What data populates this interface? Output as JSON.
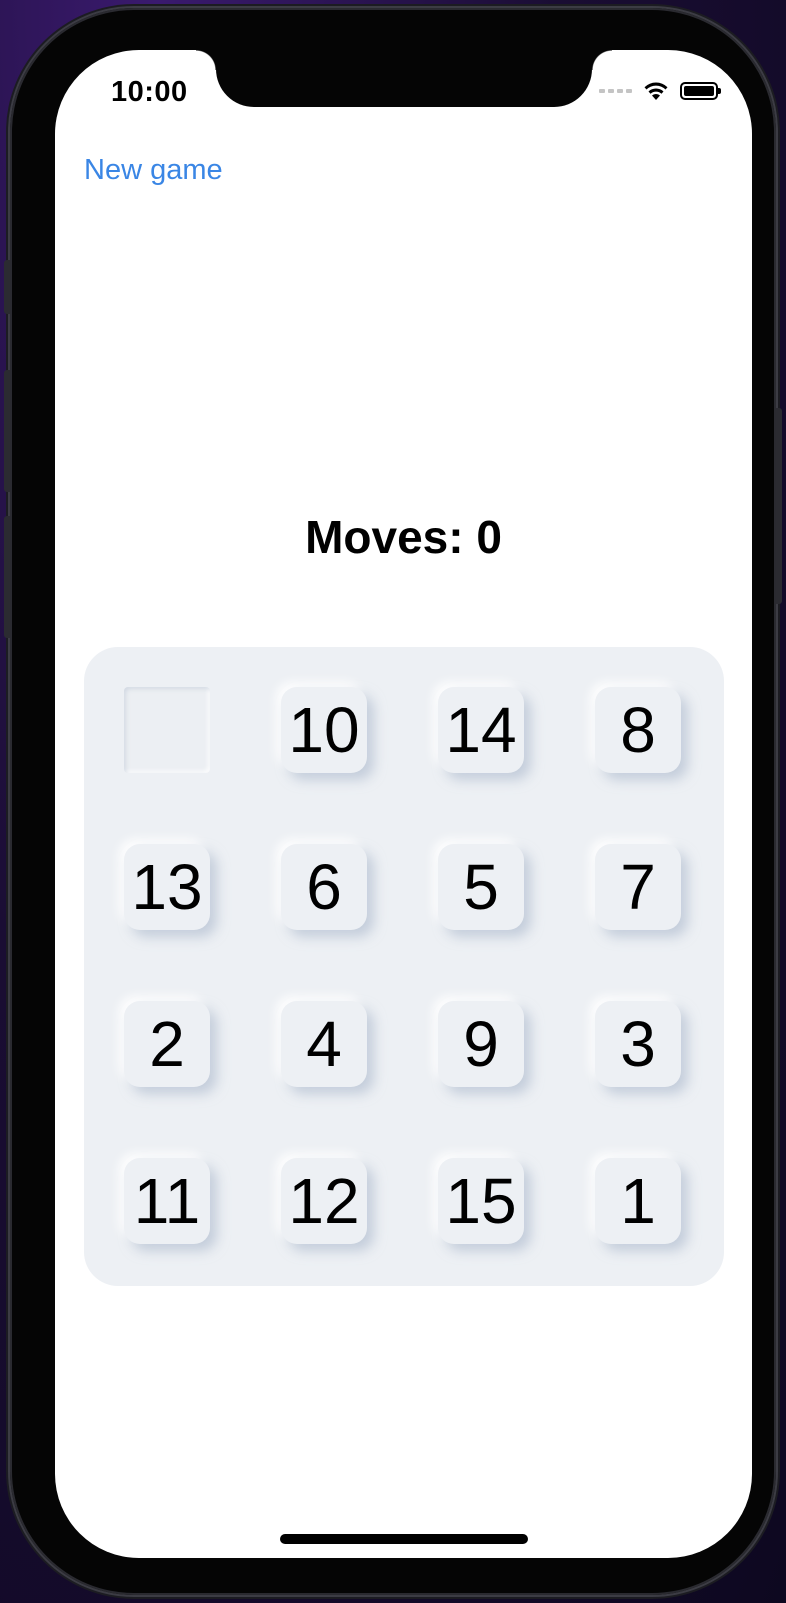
{
  "status_bar": {
    "time": "10:00",
    "icons": [
      "cellular-signal-icon",
      "wifi-icon",
      "battery-icon"
    ]
  },
  "nav": {
    "new_game_label": "New game"
  },
  "game": {
    "moves_text": "Moves: 0",
    "tiles": [
      "",
      "10",
      "14",
      "8",
      "13",
      "6",
      "5",
      "7",
      "2",
      "4",
      "9",
      "3",
      "11",
      "12",
      "15",
      "1"
    ]
  },
  "colors": {
    "link": "#3a86e5",
    "board": "#edf0f4",
    "background": "#ffffff"
  }
}
